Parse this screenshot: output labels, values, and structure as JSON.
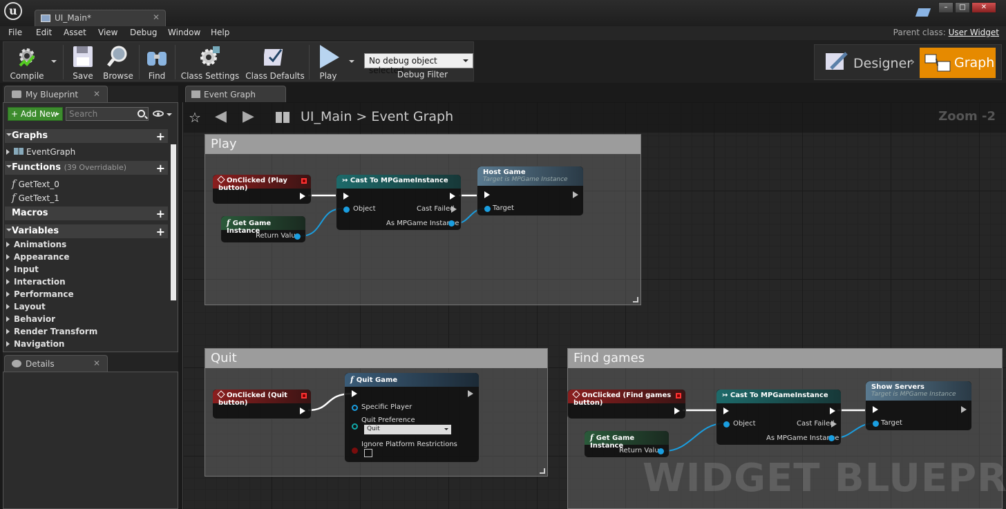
{
  "window": {
    "doc_tab": "UI_Main*",
    "min": "–",
    "max": "□",
    "close": "✕"
  },
  "menu": [
    "File",
    "Edit",
    "Asset",
    "View",
    "Debug",
    "Window",
    "Help"
  ],
  "parent_class": {
    "label": "Parent class:",
    "value": "User Widget"
  },
  "toolbar": {
    "compile": "Compile",
    "save": "Save",
    "browse": "Browse",
    "find": "Find",
    "class_settings": "Class Settings",
    "class_defaults": "Class Defaults",
    "play": "Play",
    "debug_object": "No debug object selected",
    "debug_filter": "Debug Filter",
    "designer": "Designer",
    "graph": "Graph"
  },
  "my_blueprint": {
    "tab": "My Blueprint",
    "add_new": "Add New",
    "search_placeholder": "Search",
    "graphs": "Graphs",
    "graph_items": [
      "EventGraph"
    ],
    "functions": "Functions",
    "functions_sub": "(39 Overridable)",
    "function_items": [
      "GetText_0",
      "GetText_1"
    ],
    "macros": "Macros",
    "variables": "Variables",
    "variable_categories": [
      "Animations",
      "Appearance",
      "Input",
      "Interaction",
      "Performance",
      "Layout",
      "Behavior",
      "Render Transform",
      "Navigation"
    ]
  },
  "details": {
    "tab": "Details"
  },
  "graph": {
    "tab": "Event Graph",
    "breadcrumb_root": "UI_Main",
    "breadcrumb_sep": ">",
    "breadcrumb_current": "Event Graph",
    "zoom": "Zoom -2",
    "watermark": "WIDGET BLUEPRINT"
  },
  "comments": {
    "play": "Play",
    "quit": "Quit",
    "find": "Find games"
  },
  "nodes": {
    "play_event": "OnClicked (Play button)",
    "play_get_instance": "Get Game Instance",
    "return_value": "Return Value",
    "cast": "Cast To MPGameInstance",
    "object": "Object",
    "cast_failed": "Cast Failed",
    "as_instance": "As MPGame Instance",
    "host_game": "Host Game",
    "target_sub": "Target is MPGame Instance",
    "target": "Target",
    "quit_event": "OnClicked (Quit button)",
    "quit_game": "Quit Game",
    "specific_player": "Specific Player",
    "quit_pref": "Quit Preference",
    "quit_value": "Quit",
    "ignore_platform": "Ignore Platform Restrictions",
    "find_event": "OnClicked (Find games button)",
    "show_servers": "Show Servers"
  }
}
